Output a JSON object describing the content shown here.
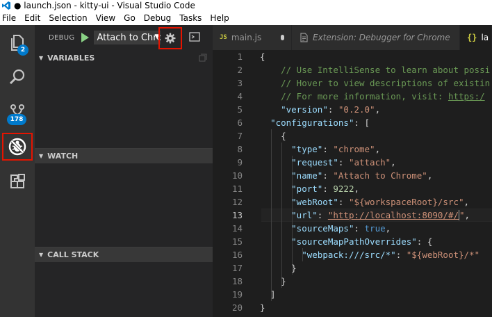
{
  "window": {
    "title": "● launch.json - kitty-ui - Visual Studio Code"
  },
  "menu": [
    "File",
    "Edit",
    "Selection",
    "View",
    "Go",
    "Debug",
    "Tasks",
    "Help"
  ],
  "activity": {
    "explorer_badge": "2",
    "scm_badge": "178"
  },
  "debug": {
    "label": "DEBUG",
    "config": "Attach to Chrome",
    "sections": {
      "variables": "VARIABLES",
      "watch": "WATCH",
      "callstack": "CALL STACK"
    }
  },
  "tabs": [
    {
      "icon": "JS",
      "label": "main.js"
    },
    {
      "label": "Extension: Debugger for Chrome"
    },
    {
      "icon": "{}",
      "label": "la"
    }
  ],
  "editor": {
    "line_numbers": [
      "1",
      "2",
      "3",
      "4",
      "5",
      "6",
      "7",
      "8",
      "9",
      "10",
      "11",
      "12",
      "13",
      "14",
      "15",
      "16",
      "17",
      "18",
      "19",
      "20"
    ],
    "current_line": 13,
    "lines": [
      [
        {
          "t": "{",
          "c": "punc"
        }
      ],
      [
        {
          "t": "    // Use IntelliSense to learn about possi",
          "c": "comment"
        }
      ],
      [
        {
          "t": "    // Hover to view descriptions of existin",
          "c": "comment"
        }
      ],
      [
        {
          "t": "    // For more information, visit: ",
          "c": "comment"
        },
        {
          "t": "https:/",
          "c": "link"
        }
      ],
      [
        {
          "t": "    ",
          "c": "punc"
        },
        {
          "t": "\"version\"",
          "c": "key"
        },
        {
          "t": ": ",
          "c": "punc"
        },
        {
          "t": "\"0.2.0\"",
          "c": "str"
        },
        {
          "t": ",",
          "c": "punc"
        }
      ],
      [
        {
          "t": "  ",
          "c": "punc"
        },
        {
          "t": "\"configurations\"",
          "c": "key"
        },
        {
          "t": ": [",
          "c": "punc"
        }
      ],
      [
        {
          "t": "    {",
          "c": "punc"
        }
      ],
      [
        {
          "t": "      ",
          "c": "punc"
        },
        {
          "t": "\"type\"",
          "c": "key"
        },
        {
          "t": ": ",
          "c": "punc"
        },
        {
          "t": "\"chrome\"",
          "c": "str"
        },
        {
          "t": ",",
          "c": "punc"
        }
      ],
      [
        {
          "t": "      ",
          "c": "punc"
        },
        {
          "t": "\"request\"",
          "c": "key"
        },
        {
          "t": ": ",
          "c": "punc"
        },
        {
          "t": "\"attach\"",
          "c": "str"
        },
        {
          "t": ",",
          "c": "punc"
        }
      ],
      [
        {
          "t": "      ",
          "c": "punc"
        },
        {
          "t": "\"name\"",
          "c": "key"
        },
        {
          "t": ": ",
          "c": "punc"
        },
        {
          "t": "\"Attach to Chrome\"",
          "c": "str"
        },
        {
          "t": ",",
          "c": "punc"
        }
      ],
      [
        {
          "t": "      ",
          "c": "punc"
        },
        {
          "t": "\"port\"",
          "c": "key"
        },
        {
          "t": ": ",
          "c": "punc"
        },
        {
          "t": "9222",
          "c": "num"
        },
        {
          "t": ",",
          "c": "punc"
        }
      ],
      [
        {
          "t": "      ",
          "c": "punc"
        },
        {
          "t": "\"webRoot\"",
          "c": "key"
        },
        {
          "t": ": ",
          "c": "punc"
        },
        {
          "t": "\"${workspaceRoot}/src\"",
          "c": "str"
        },
        {
          "t": ",",
          "c": "punc"
        }
      ],
      [
        {
          "t": "      ",
          "c": "punc"
        },
        {
          "t": "\"url\"",
          "c": "key"
        },
        {
          "t": ": ",
          "c": "punc"
        },
        {
          "t": "\"http://localhost:8090/#/",
          "c": "urlstr"
        },
        {
          "t": "",
          "c": "cursor"
        },
        {
          "t": "\"",
          "c": "str"
        },
        {
          "t": ",",
          "c": "punc"
        }
      ],
      [
        {
          "t": "      ",
          "c": "punc"
        },
        {
          "t": "\"sourceMaps\"",
          "c": "key"
        },
        {
          "t": ": ",
          "c": "punc"
        },
        {
          "t": "true",
          "c": "bool"
        },
        {
          "t": ",",
          "c": "punc"
        }
      ],
      [
        {
          "t": "      ",
          "c": "punc"
        },
        {
          "t": "\"sourceMapPathOverrides\"",
          "c": "key"
        },
        {
          "t": ": {",
          "c": "punc"
        }
      ],
      [
        {
          "t": "        ",
          "c": "punc"
        },
        {
          "t": "\"webpack:///src/*\"",
          "c": "key"
        },
        {
          "t": ": ",
          "c": "punc"
        },
        {
          "t": "\"${webRoot}/*\"",
          "c": "str"
        }
      ],
      [
        {
          "t": "      }",
          "c": "punc"
        }
      ],
      [
        {
          "t": "    }",
          "c": "punc"
        }
      ],
      [
        {
          "t": "  ]",
          "c": "punc"
        }
      ],
      [
        {
          "t": "}",
          "c": "punc"
        }
      ]
    ]
  },
  "colors": {
    "highlight_box": "#e51400",
    "badge": "#007acc",
    "play": "#89d185"
  }
}
